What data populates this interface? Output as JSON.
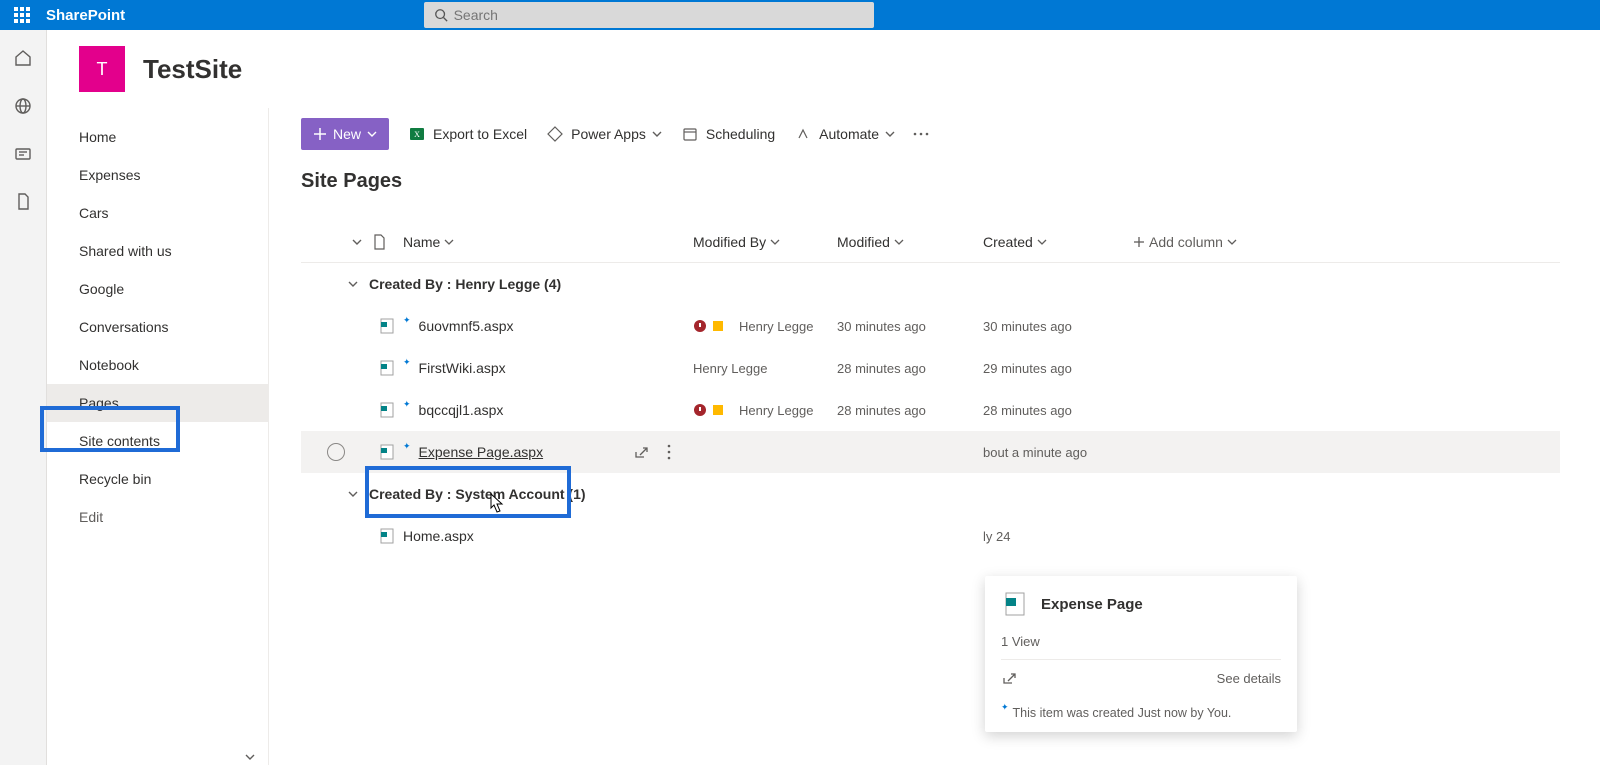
{
  "suite": {
    "brand": "SharePoint",
    "search_placeholder": "Search"
  },
  "site": {
    "avatar_letter": "T",
    "title": "TestSite"
  },
  "quick_launch": {
    "items": [
      "Home",
      "Expenses",
      "Cars",
      "Shared with us",
      "Google",
      "Conversations",
      "Notebook",
      "Pages",
      "Site contents",
      "Recycle bin",
      "Edit"
    ],
    "active_index": 7
  },
  "command_bar": {
    "new_label": "New",
    "export_label": "Export to Excel",
    "powerapps_label": "Power Apps",
    "scheduling_label": "Scheduling",
    "automate_label": "Automate"
  },
  "page": {
    "title": "Site Pages"
  },
  "columns": {
    "name": "Name",
    "modified_by": "Modified By",
    "modified": "Modified",
    "created": "Created",
    "add": "Add column"
  },
  "groups": [
    {
      "header": "Created By : Henry Legge (4)",
      "rows": [
        {
          "name": "6uovmnf5.aspx",
          "has_status": true,
          "modified_by": "Henry Legge",
          "modified": "30 minutes ago",
          "created": "30 minutes ago"
        },
        {
          "name": "FirstWiki.aspx",
          "has_status": false,
          "modified_by": "Henry Legge",
          "modified": "28 minutes ago",
          "created": "29 minutes ago"
        },
        {
          "name": "bqccqjl1.aspx",
          "has_status": true,
          "modified_by": "Henry Legge",
          "modified": "28 minutes ago",
          "created": "28 minutes ago"
        },
        {
          "name": "Expense Page.aspx",
          "has_status": false,
          "modified_by": "",
          "modified": "",
          "created": "bout a minute ago",
          "hover": true
        }
      ]
    },
    {
      "header": "Created By : System Account (1)",
      "rows": [
        {
          "name": "Home.aspx",
          "has_status": false,
          "modified_by": "",
          "modified": "",
          "created": "ly 24"
        }
      ]
    }
  ],
  "hover_card": {
    "title": "Expense Page",
    "views": "1 View",
    "see_details": "See details",
    "activity": "This item was created Just now by You."
  }
}
